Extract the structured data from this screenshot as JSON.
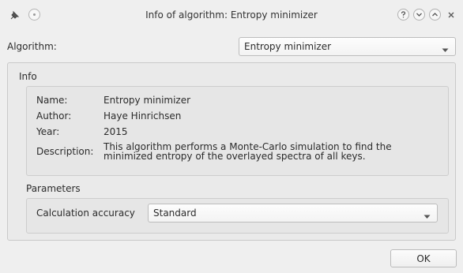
{
  "window": {
    "title": "Info of algorithm: Entropy minimizer"
  },
  "algorithm": {
    "label": "Algorithm:",
    "selected": "Entropy minimizer"
  },
  "info": {
    "group_title": "Info",
    "rows": [
      {
        "label": "Name:",
        "value": "Entropy minimizer"
      },
      {
        "label": "Author:",
        "value": "Haye Hinrichsen"
      },
      {
        "label": "Year:",
        "value": "2015"
      }
    ],
    "description_label": "Description:",
    "description_line1": "This algorithm performs a Monte-Carlo simulation to find the",
    "description_line2": "minimized entropy of the overlayed spectra of all keys."
  },
  "parameters": {
    "group_title": "Parameters",
    "calc_label": "Calculation accuracy",
    "calc_selected": "Standard"
  },
  "buttons": {
    "ok_label": "OK"
  },
  "icons": {
    "app": "pin-icon",
    "sticky": "sticky-icon",
    "help": "help-icon",
    "minimize": "minimize-icon",
    "maximize": "maximize-icon",
    "close": "close-icon",
    "dropdown": "chevron-down-icon"
  }
}
